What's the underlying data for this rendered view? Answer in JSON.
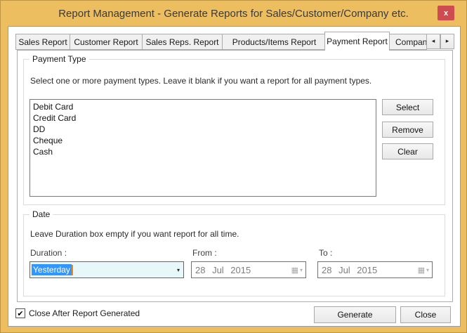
{
  "window": {
    "title": "Report Management - Generate Reports for Sales/Customer/Company etc.",
    "titlebar_color": "#ECBE60",
    "close_button_color": "#CE4B50"
  },
  "icons": {
    "close_icon": "x",
    "scroll_left_icon": "◂",
    "scroll_right_icon": "▸",
    "dropdown_arrow_icon": "▾",
    "calendar_icon": "▦",
    "check_mark_icon": "✔"
  },
  "tabs": {
    "items": [
      {
        "label": "Sales Report"
      },
      {
        "label": "Customer Report"
      },
      {
        "label": "Sales Reps. Report"
      },
      {
        "label": "Products/Items Report"
      },
      {
        "label": "Payment Report",
        "active": true
      },
      {
        "label": "Company",
        "truncated": true
      }
    ]
  },
  "payment_type": {
    "legend": "Payment Type",
    "instruction": "Select one or more payment types. Leave it blank if you want a report for all payment types.",
    "items": [
      "Debit Card",
      "Credit Card",
      "DD",
      "Cheque",
      "Cash"
    ],
    "buttons": {
      "select": "Select",
      "remove": "Remove",
      "clear": "Clear"
    }
  },
  "date": {
    "legend": "Date",
    "instruction": "Leave Duration box empty if you want report for all time.",
    "duration_label": "Duration :",
    "from_label": "From :",
    "to_label": "To :",
    "duration_value": "Yesterday",
    "duration_selection_color": "#3297FD",
    "combo_background_color": "#E7F7FA",
    "from_value": "28 Jul 2015",
    "to_value": "28 Jul 2015",
    "pickers_disabled": true
  },
  "footer": {
    "checkbox_label": "Close After Report Generated",
    "checkbox_checked": true,
    "generate_label": "Generate",
    "close_label": "Close"
  }
}
